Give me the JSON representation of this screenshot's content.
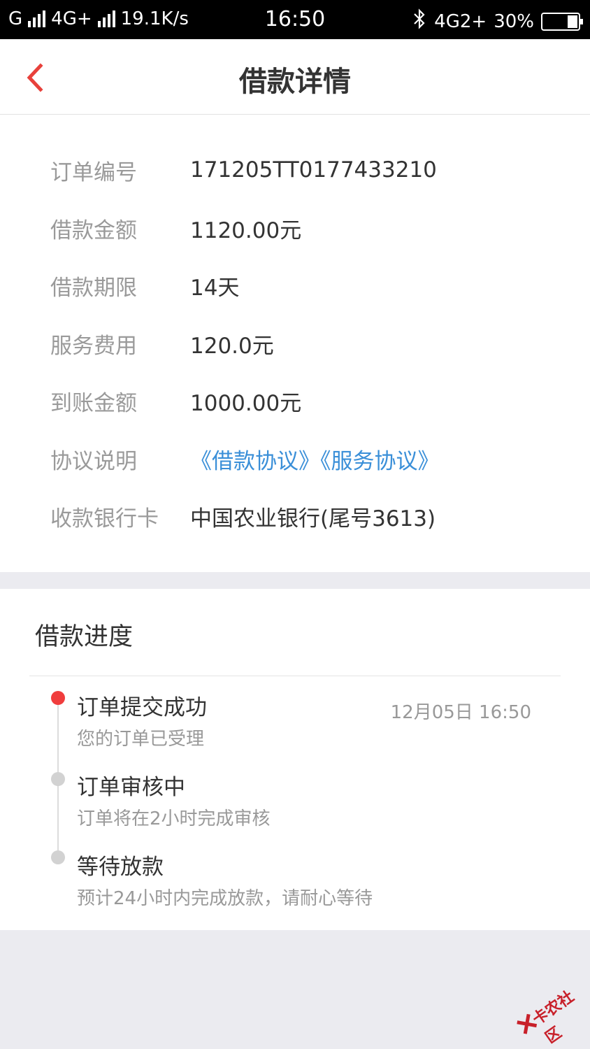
{
  "status_bar": {
    "carrier1": "G",
    "carrier2": "4G+",
    "speed": "19.1K/s",
    "time": "16:50",
    "network": "4G2+",
    "battery": "30%",
    "battery_level": 0.3,
    "icons": [
      "signal-icon",
      "bluetooth-icon",
      "battery-icon"
    ]
  },
  "nav": {
    "title": "借款详情",
    "back_icon": "chevron-left-icon",
    "accent_color": "#e8413b"
  },
  "details": [
    {
      "label": "订单编号",
      "value": "171205TT0177433210"
    },
    {
      "label": "借款金额",
      "value": "1120.00元"
    },
    {
      "label": "借款期限",
      "value": "14天"
    },
    {
      "label": "服务费用",
      "value": "120.0元"
    },
    {
      "label": "到账金额",
      "value": "1000.00元"
    },
    {
      "label": "协议说明",
      "value": "《借款协议》《服务协议》"
    },
    {
      "label": "收款银行卡",
      "value": "中国农业银行(尾号3613)"
    }
  ],
  "link_color": "#3a8fd8",
  "progress": {
    "title": "借款进度",
    "steps": [
      {
        "title": "订单提交成功",
        "desc": "您的订单已受理",
        "time": "12月05日 16:50",
        "active": true
      },
      {
        "title": "订单审核中",
        "desc": "订单将在2小时完成审核",
        "time": "",
        "active": false
      },
      {
        "title": "等待放款",
        "desc": "预计24小时内完成放款，请耐心等待",
        "time": "",
        "active": false
      }
    ]
  },
  "watermark": {
    "text": "卡农社区"
  }
}
